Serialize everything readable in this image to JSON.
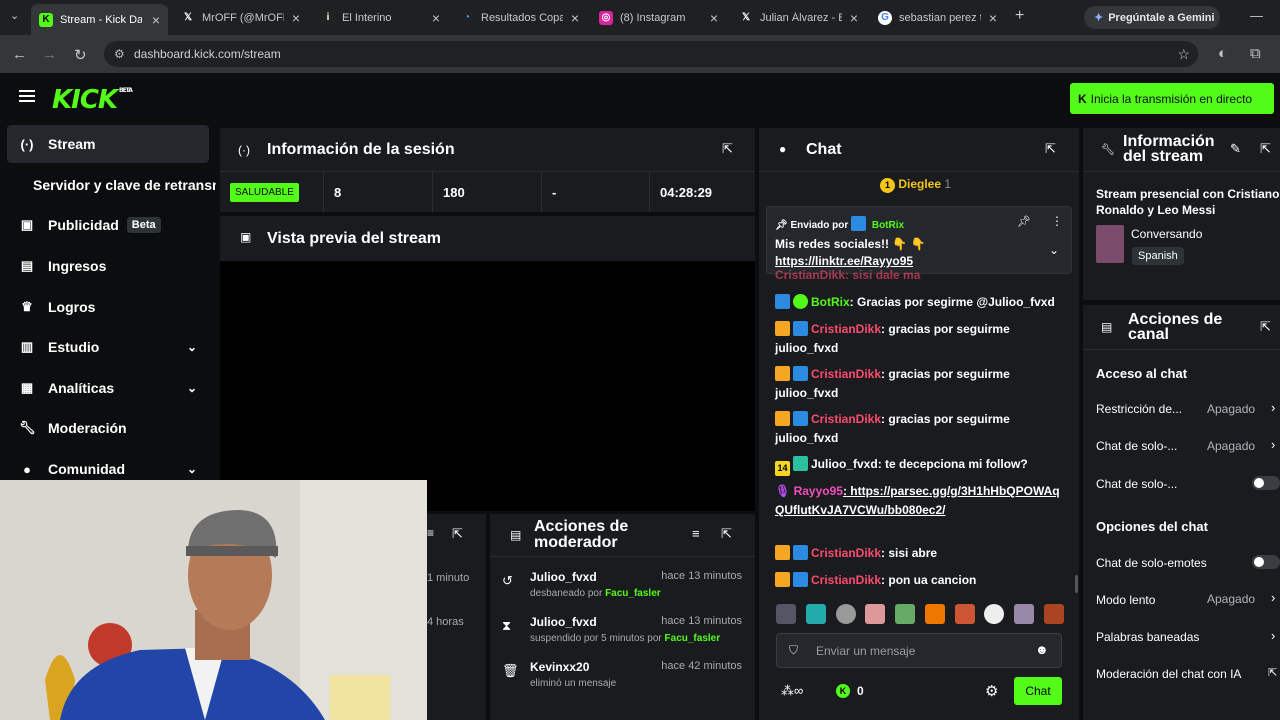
{
  "browser": {
    "tabs": [
      {
        "title": "Stream - Kick Das",
        "icon": "K"
      },
      {
        "title": "MrOFF (@MrOFF",
        "icon": "X"
      },
      {
        "title": "El Interino",
        "icon": "i"
      },
      {
        "title": "Resultados Copa",
        "icon": "c"
      },
      {
        "title": "(8) Instagram",
        "icon": "ig"
      },
      {
        "title": "Julian Álvarez - B",
        "icon": "X"
      },
      {
        "title": "sebastian perez t",
        "icon": "G"
      }
    ],
    "gemini": "Pregúntale a Gemini",
    "url": "dashboard.kick.com/stream"
  },
  "header": {
    "logo": "KICK",
    "beta": "BETA",
    "go_live": "Inicia la transmisión en directo"
  },
  "sidebar": {
    "items": [
      {
        "label": "Stream"
      },
      {
        "label": "Servidor y clave de retransmisión"
      },
      {
        "label": "Publicidad",
        "badge": "Beta"
      },
      {
        "label": "Ingresos"
      },
      {
        "label": "Logros"
      },
      {
        "label": "Estudio"
      },
      {
        "label": "Analíticas"
      },
      {
        "label": "Moderación"
      },
      {
        "label": "Comunidad"
      }
    ]
  },
  "session": {
    "title": "Información de la sesión",
    "status": "SALUDABLE",
    "stats": [
      "8",
      "180",
      "-",
      "04:28:29"
    ]
  },
  "preview": {
    "title": "Vista previa del stream"
  },
  "activity": {
    "times": [
      "1 minuto",
      "4 horas"
    ]
  },
  "modactions": {
    "title": "Acciones de moderador",
    "items": [
      {
        "user": "Julioo_fvxd",
        "time": "hace 13 minutos",
        "action": "desbaneado por",
        "by": "Facu_fasler"
      },
      {
        "user": "Julioo_fvxd",
        "time": "hace 13 minutos",
        "action": "suspendido por 5 minutos por",
        "by": "Facu_fasler"
      },
      {
        "user": "Kevinxx20",
        "time": "hace 42 minutos",
        "action": "eliminó un mensaje",
        "by": ""
      }
    ]
  },
  "chat": {
    "title": "Chat",
    "top_gifter": "Dieglee",
    "top_gifter_count": "1",
    "pinned": {
      "label": "Enviado por",
      "user": "BotRix",
      "text": "Mis redes sociales!! 👇 👇",
      "link": "https://linktr.ee/Rayyo95"
    },
    "partial": "CristianDikk: sisi dale ma",
    "messages": [
      {
        "user": "BotRix",
        "text": ": Gracias por segirme @Julioo_fvxd",
        "color": "grn"
      },
      {
        "user": "CristianDikk",
        "text": ": gracias por seguirme julioo_fvxd",
        "color": "red"
      },
      {
        "user": "CristianDikk",
        "text": ": gracias por seguirme julioo_fvxd",
        "color": "red"
      },
      {
        "user": "CristianDikk",
        "text": ": gracias por seguirme julioo_fvxd",
        "color": "red"
      },
      {
        "user": "Julioo_fvxd",
        "text": ": te decepciona mi follow?",
        "color": "white",
        "badge": "14"
      },
      {
        "user": "Rayyo95",
        "text": ": https://parsec.gg/g/3H1hHbQPOWAqQUflutKvJA7VCWu/bb080ec2/",
        "color": "pink"
      },
      {
        "user": "CristianDikk",
        "text": ": sisi abre",
        "color": "red"
      },
      {
        "user": "CristianDikk",
        "text": ": pon ua cancion",
        "color": "red"
      }
    ],
    "placeholder": "Enviar un mensaje",
    "points": "0",
    "send": "Chat"
  },
  "streaminfo": {
    "title": "Información del stream",
    "stream_title": "Stream presencial con Cristiano Ronaldo y Leo Messi",
    "category": "Conversando",
    "language": "Spanish"
  },
  "channel": {
    "title": "Acciones de canal",
    "access": "Acceso al chat",
    "rows": [
      {
        "label": "Restricción de...",
        "value": "Apagado"
      },
      {
        "label": "Chat de solo-...",
        "value": "Apagado"
      },
      {
        "label": "Chat de solo-...",
        "value": ""
      }
    ],
    "options": "Opciones del chat",
    "orows": [
      {
        "label": "Chat de solo-emotes",
        "value": ""
      },
      {
        "label": "Modo lento",
        "value": "Apagado"
      },
      {
        "label": "Palabras baneadas",
        "value": ""
      },
      {
        "label": "Moderación del chat con IA",
        "value": ""
      }
    ]
  },
  "colors": {
    "accent": "#53fc18",
    "panel": "#191b1f",
    "bg": "#0b0d0f"
  }
}
